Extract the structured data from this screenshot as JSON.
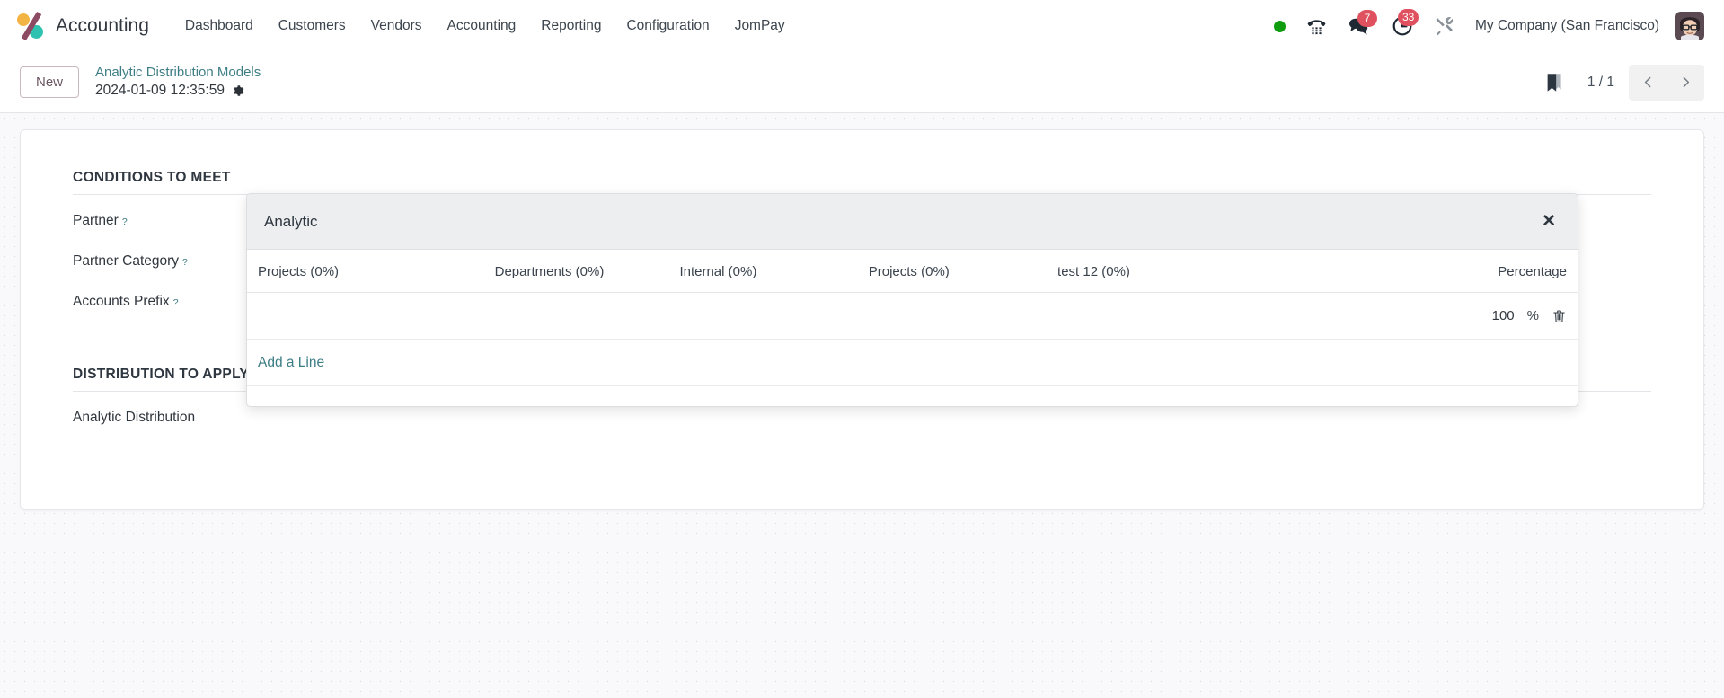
{
  "navbar": {
    "brand": "Accounting",
    "logo_icon": "odoo-accounting-logo-icon",
    "menu": [
      {
        "label": "Dashboard"
      },
      {
        "label": "Customers"
      },
      {
        "label": "Vendors"
      },
      {
        "label": "Accounting"
      },
      {
        "label": "Reporting"
      },
      {
        "label": "Configuration"
      },
      {
        "label": "JomPay"
      }
    ],
    "systray": {
      "presence_icon": "green-status-dot-icon",
      "phone_icon": "phone-dialpad-icon",
      "messages_icon": "chat-bubbles-icon",
      "messages_count": "7",
      "activities_icon": "clock-activity-icon",
      "activities_count": "33",
      "debug_icon": "tools-wrench-icon",
      "company": "My Company (San Francisco)",
      "avatar_icon": "user-avatar-icon"
    }
  },
  "control_panel": {
    "new_label": "New",
    "breadcrumb_parent": "Analytic Distribution Models",
    "breadcrumb_current": "2024-01-09 12:35:59",
    "gear_icon": "gear-icon",
    "bookmark_icon": "bookmark-icon",
    "pager": "1 / 1",
    "prev_icon": "chevron-left-icon",
    "next_icon": "chevron-right-icon"
  },
  "form": {
    "groups": [
      {
        "title": "CONDITIONS TO MEET",
        "fields": [
          {
            "label": "Partner",
            "help": "?"
          },
          {
            "label": "Partner Category",
            "help": "?"
          },
          {
            "label": "Accounts Prefix",
            "help": "?"
          }
        ]
      },
      {
        "title": "DISTRIBUTION TO APPLY",
        "fields": [
          {
            "label": "Analytic Distribution",
            "help": ""
          }
        ]
      }
    ]
  },
  "analytic_popover": {
    "title": "Analytic",
    "close_icon": "close-icon",
    "columns": [
      "Projects (0%)",
      "Departments (0%)",
      "Internal (0%)",
      "Projects (0%)",
      "test 12 (0%)",
      "Percentage"
    ],
    "rows": [
      {
        "projects_1": "",
        "departments": "",
        "internal": "",
        "projects_2": "",
        "test_12": "",
        "percentage": "100",
        "percent_sign": "%",
        "delete_icon": "trash-icon"
      }
    ],
    "add_line_label": "Add a Line"
  },
  "colors": {
    "accent": "#3d7d85",
    "badge": "#e0515f",
    "presence": "#0f9d0f",
    "brand_purple": "#8d4a63",
    "brand_yellow": "#f2b544",
    "brand_teal": "#2fc2b0"
  }
}
